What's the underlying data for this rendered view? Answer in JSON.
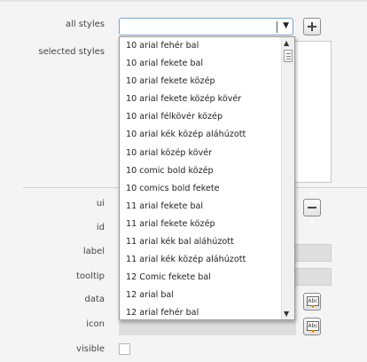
{
  "labels": {
    "all_styles": "all styles",
    "selected_styles": "selected styles",
    "ui": "ui",
    "id": "id",
    "label": "label",
    "tooltip": "tooltip",
    "data": "data",
    "icon": "icon",
    "visible": "visible"
  },
  "combo": {
    "value": "",
    "arrow": "▼"
  },
  "dropdown_items": [
    "10 arial fehér bal",
    "10 arial fekete bal",
    "10 arial fekete közép",
    "10 arial fekete közép kövér",
    "10 arial félkövér közép",
    "10 arial kék közép aláhúzott",
    "10 arial közép kövér",
    "10 comic bold közép",
    "10 comics bold fekete",
    "11 arial fekete bal",
    "11 arial fekete közép",
    "11 arial kék bal aláhúzott",
    "11 arial kék közép aláhúzott",
    "12 Comic fekete bal",
    "12 arial bal",
    "12 arial fehér bal"
  ],
  "scrollbar": {
    "up": "▲",
    "down": "▼"
  },
  "buttons": {
    "abc": "Abc"
  },
  "icons": [
    "plus-icon",
    "minus-icon",
    "abc-edit-icon",
    "chevron-down-icon"
  ]
}
